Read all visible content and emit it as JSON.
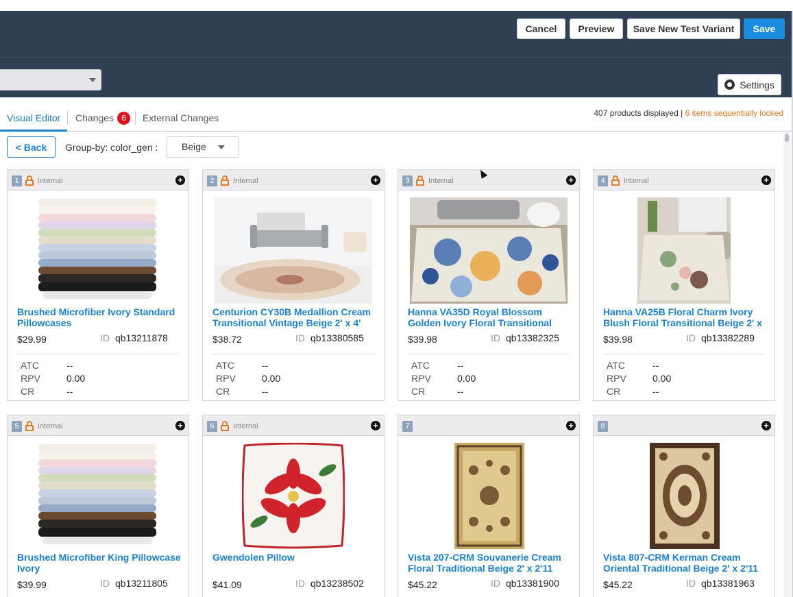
{
  "header": {
    "cancel_label": "Cancel",
    "preview_label": "Preview",
    "save_variant_label": "Save New Test Variant",
    "save_label": "Save",
    "settings_label": "Settings"
  },
  "tabs": {
    "visual_editor": "Visual Editor",
    "changes": "Changes",
    "changes_count": "6",
    "external_changes": "External Changes"
  },
  "status": {
    "products_displayed": "407 products displayed",
    "separator": "|",
    "locked_items": "6 items sequentially locked"
  },
  "toolbar": {
    "back_label": "< Back",
    "group_by_label": "Group-by: color_gen :",
    "group_value": "Beige"
  },
  "metric_labels": {
    "atc": "ATC",
    "rpv": "RPV",
    "cr": "CR"
  },
  "id_label": "ID",
  "products": [
    {
      "num": "1",
      "internal": "Internal",
      "locked": true,
      "title": "Brushed Microfiber Ivory Standard Pillowcases",
      "price": "$29.99",
      "id": "qb13211878",
      "atc": "--",
      "rpv": "0.00",
      "cr": "--",
      "image": "folded-sheets"
    },
    {
      "num": "2",
      "internal": "Internal",
      "locked": true,
      "title": "Centurion CY30B Medallion Cream Transitional Vintage Beige 2' x 4'",
      "price": "$38.72",
      "id": "qb13380585",
      "atc": "--",
      "rpv": "0.00",
      "cr": "--",
      "image": "living-room-rug"
    },
    {
      "num": "3",
      "internal": "Internal",
      "locked": true,
      "title": "Hanna VA35D Royal Blossom Golden Ivory Floral Transitional",
      "price": "$39.98",
      "id": "qb13382325",
      "atc": "--",
      "rpv": "0.00",
      "cr": "--",
      "image": "floral-rug-room"
    },
    {
      "num": "4",
      "internal": "Internal",
      "locked": true,
      "title": "Hanna VA25B Floral Charm Ivory Blush Floral Transitional Beige 2' x",
      "price": "$39.98",
      "id": "qb13382289",
      "atc": "--",
      "rpv": "0.00",
      "cr": "--",
      "image": "floral-charm-rug"
    },
    {
      "num": "5",
      "internal": "Internal",
      "locked": true,
      "title": "Brushed Microfiber King Pillowcase Ivory",
      "price": "$39.99",
      "id": "qb13211805",
      "image": "folded-sheets"
    },
    {
      "num": "6",
      "internal": "Internal",
      "locked": true,
      "title": "Gwendolen Pillow",
      "price": "$41.09",
      "id": "qb13238502",
      "image": "poinsettia-pillow"
    },
    {
      "num": "7",
      "internal": "",
      "locked": false,
      "title": "Vista 207-CRM Souvanerie Cream Floral Traditional Beige 2' x 2'11",
      "price": "$45.22",
      "id": "qb13381900",
      "image": "traditional-rug"
    },
    {
      "num": "8",
      "internal": "",
      "locked": false,
      "title": "Vista 807-CRM Kerman Cream Oriental Traditional Beige 2' x 2'11",
      "price": "$45.22",
      "id": "qb13381963",
      "image": "kerman-rug"
    }
  ],
  "colors": {
    "header_bg": "#2f4053",
    "accent": "#1b7fcc",
    "save_bg": "#1b8de0",
    "lock_orange": "#e37b25",
    "badge_red": "#e3101a"
  }
}
